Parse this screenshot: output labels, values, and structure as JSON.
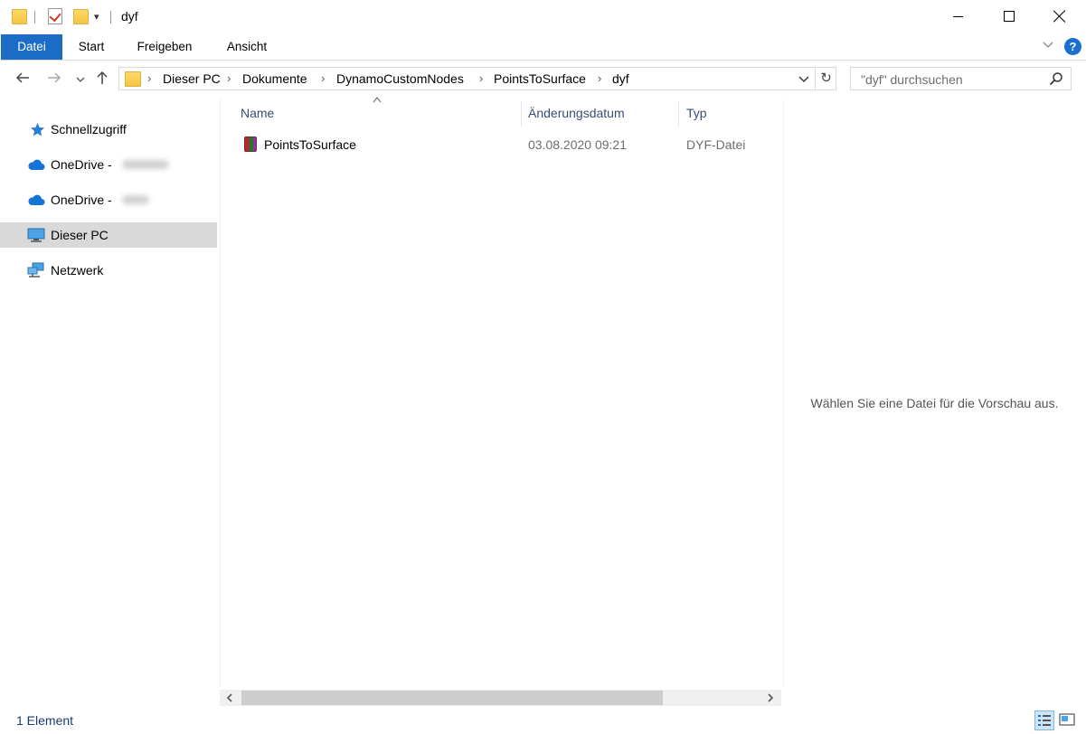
{
  "window": {
    "title": "dyf"
  },
  "ribbon": {
    "tabs": [
      {
        "label": "Datei"
      },
      {
        "label": "Start"
      },
      {
        "label": "Freigeben"
      },
      {
        "label": "Ansicht"
      }
    ],
    "help_label": "?"
  },
  "nav": {
    "breadcrumb": [
      "Dieser PC",
      "Dokumente",
      "DynamoCustomNodes",
      "PointsToSurface",
      "dyf"
    ],
    "search_placeholder": "\"dyf\" durchsuchen"
  },
  "sidebar": {
    "items": [
      {
        "label": "Schnellzugriff",
        "icon": "star-icon"
      },
      {
        "label": "OneDrive - ",
        "icon": "onedrive-cloud-icon"
      },
      {
        "label": "OneDrive - ",
        "icon": "onedrive-cloud-icon"
      },
      {
        "label": "Dieser PC",
        "icon": "computer-icon",
        "selected": true
      },
      {
        "label": "Netzwerk",
        "icon": "network-icon"
      }
    ]
  },
  "file_list": {
    "columns": [
      "Name",
      "Änderungsdatum",
      "Typ"
    ],
    "rows": [
      {
        "name": "PointsToSurface",
        "date": "03.08.2020 09:21",
        "type": "DYF-Datei"
      }
    ]
  },
  "preview": {
    "message": "Wählen Sie eine Datei für die Vorschau aus."
  },
  "status": {
    "count": "1 Element"
  },
  "colors": {
    "accent": "#1a6cc4",
    "selection": "#d9d9d9"
  }
}
